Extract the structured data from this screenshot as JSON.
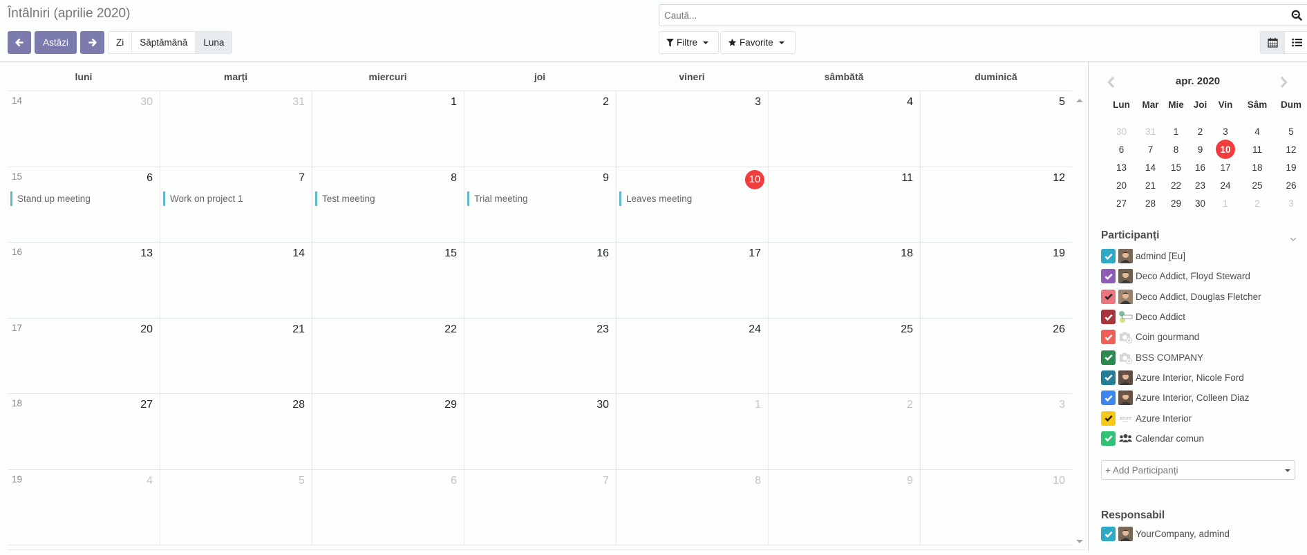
{
  "header": {
    "title": "Întâlniri (aprilie 2020)",
    "today_label": "Astăzi",
    "scales": [
      {
        "label": "Zi",
        "active": false
      },
      {
        "label": "Săptămână",
        "active": false
      },
      {
        "label": "Luna",
        "active": true
      }
    ],
    "search_placeholder": "Caută...",
    "filters_label": "Filtre",
    "favorites_label": "Favorite",
    "views": [
      {
        "name": "calendar-view",
        "active": true
      },
      {
        "name": "list-view",
        "active": false
      }
    ]
  },
  "month": {
    "weekdays": [
      "luni",
      "marți",
      "miercuri",
      "joi",
      "vineri",
      "sâmbătă",
      "duminică"
    ],
    "weeks": [
      {
        "week": "14",
        "days": [
          {
            "d": "30",
            "other": true
          },
          {
            "d": "31",
            "other": true
          },
          {
            "d": "1"
          },
          {
            "d": "2"
          },
          {
            "d": "3"
          },
          {
            "d": "4"
          },
          {
            "d": "5"
          }
        ]
      },
      {
        "week": "15",
        "days": [
          {
            "d": "6",
            "event": "Stand up meeting"
          },
          {
            "d": "7",
            "event": "Work on project 1"
          },
          {
            "d": "8",
            "event": "Test meeting"
          },
          {
            "d": "9",
            "event": "Trial meeting"
          },
          {
            "d": "10",
            "today": true,
            "event": "Leaves meeting"
          },
          {
            "d": "11"
          },
          {
            "d": "12"
          }
        ]
      },
      {
        "week": "16",
        "days": [
          {
            "d": "13"
          },
          {
            "d": "14"
          },
          {
            "d": "15"
          },
          {
            "d": "16"
          },
          {
            "d": "17"
          },
          {
            "d": "18"
          },
          {
            "d": "19"
          }
        ]
      },
      {
        "week": "17",
        "days": [
          {
            "d": "20"
          },
          {
            "d": "21"
          },
          {
            "d": "22"
          },
          {
            "d": "23"
          },
          {
            "d": "24"
          },
          {
            "d": "25"
          },
          {
            "d": "26"
          }
        ]
      },
      {
        "week": "18",
        "days": [
          {
            "d": "27"
          },
          {
            "d": "28"
          },
          {
            "d": "29"
          },
          {
            "d": "30"
          },
          {
            "d": "1",
            "other": true
          },
          {
            "d": "2",
            "other": true
          },
          {
            "d": "3",
            "other": true
          }
        ]
      },
      {
        "week": "19",
        "days": [
          {
            "d": "4",
            "other": true
          },
          {
            "d": "5",
            "other": true
          },
          {
            "d": "6",
            "other": true
          },
          {
            "d": "7",
            "other": true
          },
          {
            "d": "8",
            "other": true
          },
          {
            "d": "9",
            "other": true
          },
          {
            "d": "10",
            "other": true
          }
        ]
      }
    ],
    "event_color": "#5fb7c8",
    "today_color": "#f03e3e"
  },
  "mini_calendar": {
    "title": "apr. 2020",
    "weekdays": [
      "Lun",
      "Mar",
      "Mie",
      "Joi",
      "Vin",
      "Sâm",
      "Dum"
    ],
    "weeks": [
      [
        {
          "d": "30",
          "other": true
        },
        {
          "d": "31",
          "other": true
        },
        {
          "d": "1"
        },
        {
          "d": "2"
        },
        {
          "d": "3"
        },
        {
          "d": "4"
        },
        {
          "d": "5"
        }
      ],
      [
        {
          "d": "6"
        },
        {
          "d": "7"
        },
        {
          "d": "8"
        },
        {
          "d": "9"
        },
        {
          "d": "10",
          "today": true
        },
        {
          "d": "11"
        },
        {
          "d": "12"
        }
      ],
      [
        {
          "d": "13"
        },
        {
          "d": "14"
        },
        {
          "d": "15"
        },
        {
          "d": "16"
        },
        {
          "d": "17"
        },
        {
          "d": "18"
        },
        {
          "d": "19"
        }
      ],
      [
        {
          "d": "20"
        },
        {
          "d": "21"
        },
        {
          "d": "22"
        },
        {
          "d": "23"
        },
        {
          "d": "24"
        },
        {
          "d": "25"
        },
        {
          "d": "26"
        }
      ],
      [
        {
          "d": "27"
        },
        {
          "d": "28"
        },
        {
          "d": "29"
        },
        {
          "d": "30"
        },
        {
          "d": "1",
          "other": true
        },
        {
          "d": "2",
          "other": true
        },
        {
          "d": "3",
          "other": true
        }
      ]
    ]
  },
  "participants": {
    "title": "Participanți",
    "items": [
      {
        "label": "admind [Eu]",
        "color": "#30a9c4",
        "check": "#ffffff",
        "avatar": "photo",
        "avatar_color": "#6b5b4b"
      },
      {
        "label": "Deco Addict, Floyd Steward",
        "color": "#8f5cb5",
        "check": "#ffffff",
        "avatar": "photo",
        "avatar_color": "#5a4a3a"
      },
      {
        "label": "Deco Addict, Douglas Fletcher",
        "color": "#e9777d",
        "check": "#222222",
        "avatar": "photo",
        "avatar_color": "#a88a70"
      },
      {
        "label": "Deco Addict",
        "color": "#a8353b",
        "check": "#ffffff",
        "avatar": "logo",
        "avatar_color": "#7fbf9a"
      },
      {
        "label": "Coin gourmand",
        "color": "#ef5f55",
        "check": "#ffffff",
        "avatar": "camera",
        "avatar_color": "#cfcfcf"
      },
      {
        "label": "BSS COMPANY",
        "color": "#2b8a4f",
        "check": "#ffffff",
        "avatar": "camera",
        "avatar_color": "#cfcfcf"
      },
      {
        "label": "Azure Interior, Nicole Ford",
        "color": "#257d97",
        "check": "#ffffff",
        "avatar": "photo",
        "avatar_color": "#3a2a22"
      },
      {
        "label": "Azure Interior, Colleen Diaz",
        "color": "#3d86f0",
        "check": "#ffffff",
        "avatar": "photo",
        "avatar_color": "#4a3326"
      },
      {
        "label": "Azure Interior",
        "color": "#f5c91a",
        "check": "#222222",
        "avatar": "logo-text",
        "avatar_color": "#bbbbbb"
      },
      {
        "label": "Calendar comun",
        "color": "#32c277",
        "check": "#ffffff",
        "avatar": "users",
        "avatar_color": "#444444"
      }
    ],
    "add_placeholder": "+ Add Participanți"
  },
  "responsible": {
    "title": "Responsabil",
    "items": [
      {
        "label": "YourCompany, admind",
        "color": "#30a9c4",
        "check": "#ffffff",
        "avatar": "photo",
        "avatar_color": "#6b5b4b"
      }
    ]
  }
}
